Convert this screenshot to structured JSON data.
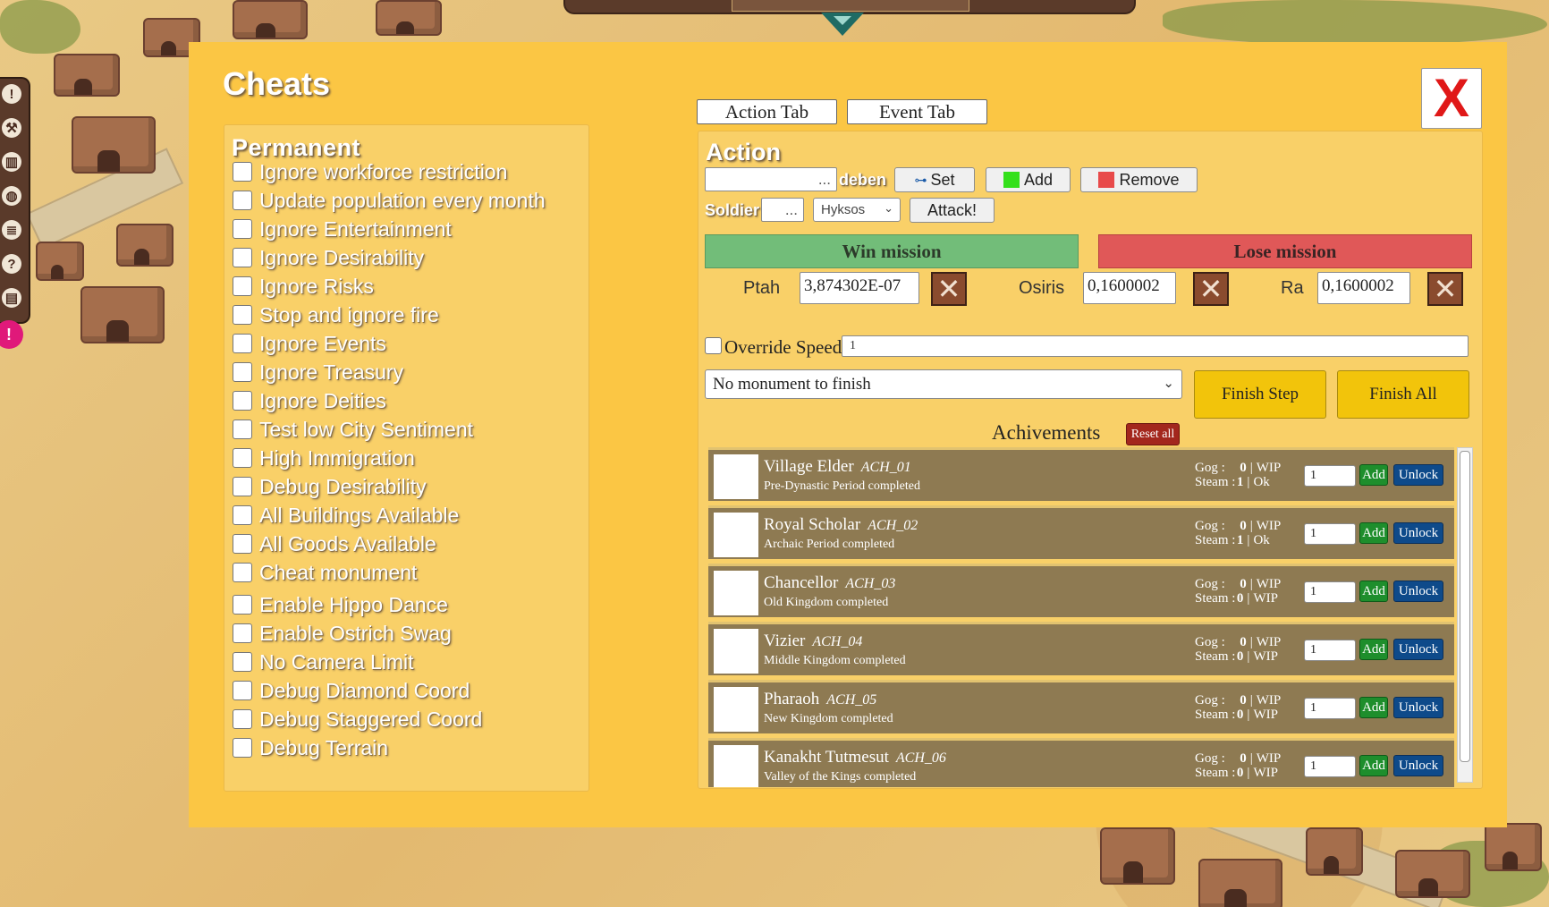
{
  "dialog": {
    "title": "Cheats",
    "close_label": "X",
    "tabs": [
      "Action Tab",
      "Event Tab"
    ]
  },
  "permanent": {
    "title": "Permanent",
    "cheats": [
      "Ignore workforce restriction",
      "Update population every month",
      "Ignore Entertainment",
      "Ignore Desirability",
      "Ignore Risks",
      "Stop and ignore fire",
      "Ignore Events",
      "Ignore Treasury",
      "Ignore Deities",
      "Test low City Sentiment",
      "High Immigration",
      "Debug Desirability",
      "All Buildings Available",
      "All Goods Available",
      "Cheat monument",
      "Enable Hippo Dance",
      "Enable Ostrich Swag",
      "No Camera Limit",
      "Debug Diamond Coord",
      "Debug Staggered Coord",
      "Debug Terrain"
    ]
  },
  "action": {
    "title": "Action",
    "deben_placeholder": "...",
    "deben_label": "deben",
    "set_label": "Set",
    "add_label": "Add",
    "remove_label": "Remove",
    "soldier_label": "Soldier",
    "soldier_placeholder": "...",
    "enemy_selected": "Hyksos",
    "attack_label": "Attack!",
    "win_label": "Win mission",
    "lose_label": "Lose mission",
    "deities": [
      {
        "name": "Ptah",
        "value": "3,874302E-07"
      },
      {
        "name": "Osiris",
        "value": "0,1600002"
      },
      {
        "name": "Ra",
        "value": "0,1600002"
      }
    ],
    "override_speed_label": "Override Speed",
    "override_speed_value": "1",
    "monument_selected": "No monument to finish",
    "finish_step_label": "Finish Step",
    "finish_all_label": "Finish All",
    "colors": {
      "add_swatch": "#33e01a",
      "remove_swatch": "#e84a4a",
      "win": "#72bd79",
      "lose": "#e05858",
      "finish": "#f2c40b"
    }
  },
  "achievements": {
    "title": "Achivements",
    "reset_label": "Reset all",
    "add_label": "Add",
    "unlock_label": "Unlock",
    "gog_label": "Gog :",
    "steam_label": "Steam :",
    "items": [
      {
        "name": "Village Elder",
        "code": "ACH_01",
        "desc": "Pre-Dynastic Period completed",
        "gog": "0",
        "gog_status": "WIP",
        "steam": "1",
        "steam_status": "Ok",
        "count": "1"
      },
      {
        "name": "Royal Scholar",
        "code": "ACH_02",
        "desc": "Archaic Period completed",
        "gog": "0",
        "gog_status": "WIP",
        "steam": "1",
        "steam_status": "Ok",
        "count": "1"
      },
      {
        "name": "Chancellor",
        "code": "ACH_03",
        "desc": "Old Kingdom completed",
        "gog": "0",
        "gog_status": "WIP",
        "steam": "0",
        "steam_status": "WIP",
        "count": "1"
      },
      {
        "name": "Vizier",
        "code": "ACH_04",
        "desc": "Middle Kingdom completed",
        "gog": "0",
        "gog_status": "WIP",
        "steam": "0",
        "steam_status": "WIP",
        "count": "1"
      },
      {
        "name": "Pharaoh",
        "code": "ACH_05",
        "desc": "New Kingdom completed",
        "gog": "0",
        "gog_status": "WIP",
        "steam": "0",
        "steam_status": "WIP",
        "count": "1"
      },
      {
        "name": "Kanakht Tutmesut",
        "code": "ACH_06",
        "desc": "Valley of the Kings completed",
        "gog": "0",
        "gog_status": "WIP",
        "steam": "0",
        "steam_status": "WIP",
        "count": "1"
      }
    ]
  },
  "toolbar_icons": [
    "alert-icon",
    "tools-icon",
    "chart-icon",
    "globe-icon",
    "list-icon",
    "help-icon",
    "save-icon"
  ],
  "toolbar_glyphs": [
    "!",
    "⚒",
    "▥",
    "◍",
    "≣",
    "?",
    "▤"
  ],
  "alert_glyph": "!"
}
